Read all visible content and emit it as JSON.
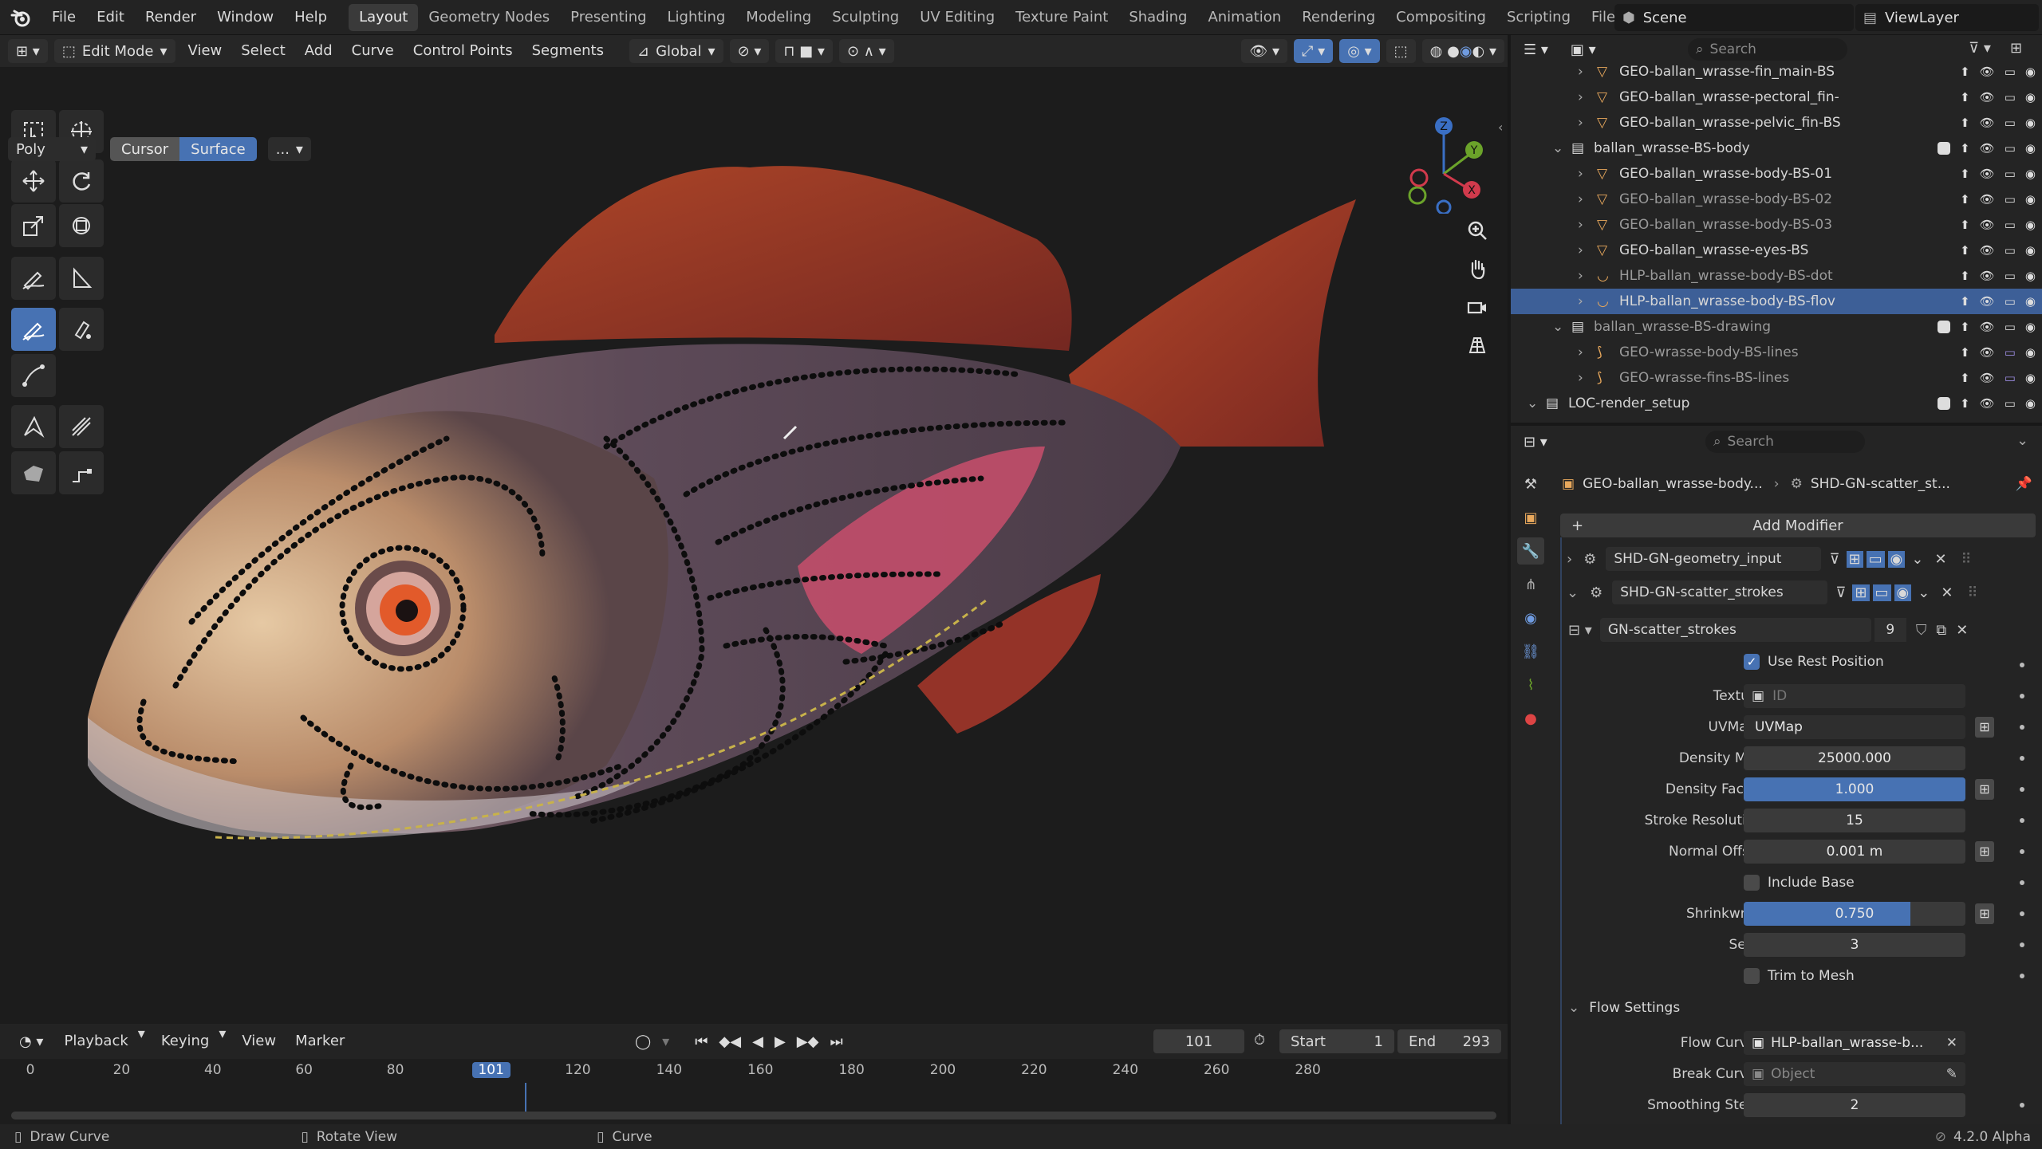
{
  "topbar": {
    "menus": [
      "File",
      "Edit",
      "Render",
      "Window",
      "Help"
    ],
    "workspaces": [
      "Layout",
      "Geometry Nodes",
      "Presenting",
      "Lighting",
      "Modeling",
      "Sculpting",
      "UV Editing",
      "Texture Paint",
      "Shading",
      "Animation",
      "Rendering",
      "Compositing",
      "Scripting",
      "File M"
    ],
    "active_workspace": "Layout",
    "scene": "Scene",
    "view_layer": "ViewLayer"
  },
  "header": {
    "mode": "Edit Mode",
    "menus": [
      "View",
      "Select",
      "Add",
      "Curve",
      "Control Points",
      "Segments"
    ],
    "transform_orientation": "Global"
  },
  "tool_settings": {
    "type": "Poly",
    "seg_cursor": "Cursor",
    "seg_surface": "Surface",
    "more": "..."
  },
  "outliner": {
    "search_placeholder": "Search",
    "rows": [
      {
        "label": "GEO-ballan_wrasse-fin_main-BS",
        "indent": 3,
        "type": "mesh"
      },
      {
        "label": "GEO-ballan_wrasse-pectoral_fin-",
        "indent": 3,
        "type": "mesh"
      },
      {
        "label": "GEO-ballan_wrasse-pelvic_fin-BS",
        "indent": 3,
        "type": "mesh"
      },
      {
        "label": "ballan_wrasse-BS-body",
        "indent": 2,
        "type": "collection"
      },
      {
        "label": "GEO-ballan_wrasse-body-BS-01",
        "indent": 3,
        "type": "mesh"
      },
      {
        "label": "GEO-ballan_wrasse-body-BS-02",
        "indent": 3,
        "type": "mesh",
        "dim": true
      },
      {
        "label": "GEO-ballan_wrasse-body-BS-03",
        "indent": 3,
        "type": "mesh",
        "dim": true
      },
      {
        "label": "GEO-ballan_wrasse-eyes-BS",
        "indent": 3,
        "type": "mesh"
      },
      {
        "label": "HLP-ballan_wrasse-body-BS-dot",
        "indent": 3,
        "type": "curve",
        "dim": true
      },
      {
        "label": "HLP-ballan_wrasse-body-BS-flov",
        "indent": 3,
        "type": "curve",
        "selected": true
      },
      {
        "label": "ballan_wrasse-BS-drawing",
        "indent": 2,
        "type": "collection",
        "dim": true
      },
      {
        "label": "GEO-wrasse-body-BS-lines",
        "indent": 3,
        "type": "gp",
        "dim": true
      },
      {
        "label": "GEO-wrasse-fins-BS-lines",
        "indent": 3,
        "type": "gp",
        "dim": true
      },
      {
        "label": "LOC-render_setup",
        "indent": 1,
        "type": "collection"
      }
    ]
  },
  "properties": {
    "search_placeholder": "Search",
    "breadcrumb_object": "GEO-ballan_wrasse-body...",
    "breadcrumb_modifier": "SHD-GN-scatter_st...",
    "add_modifier": "Add Modifier",
    "modifiers": [
      "SHD-GN-geometry_input",
      "SHD-GN-scatter_strokes"
    ],
    "node_group": "GN-scatter_strokes",
    "node_group_users": "9",
    "use_rest_position": "Use Rest Position",
    "fields": [
      {
        "label": "Texture",
        "value": "ID",
        "kind": "id"
      },
      {
        "label": "UVMap*",
        "value": "UVMap",
        "kind": "text"
      },
      {
        "label": "Density Max",
        "value": "25000.000",
        "kind": "num"
      },
      {
        "label": "Density Factor",
        "value": "1.000",
        "kind": "num",
        "fill": 1.0
      },
      {
        "label": "Stroke Resolution",
        "value": "15",
        "kind": "num"
      },
      {
        "label": "Normal Offset",
        "value": "0.001 m",
        "kind": "num"
      },
      {
        "label": "Include Base",
        "value": "",
        "kind": "check"
      },
      {
        "label": "Shrinkwrap",
        "value": "0.750",
        "kind": "num",
        "fill": 0.75
      },
      {
        "label": "Seed",
        "value": "3",
        "kind": "num"
      },
      {
        "label": "Trim to Mesh",
        "value": "",
        "kind": "check"
      }
    ],
    "flow_settings": "Flow Settings",
    "flow_curves_label": "Flow Curves",
    "flow_curves_value": "HLP-ballan_wrasse-b...",
    "break_curves_label": "Break Curves",
    "break_curves_value": "Object",
    "smoothing_steps_label": "Smoothing Steps",
    "smoothing_steps_value": "2"
  },
  "timeline": {
    "menus": [
      "Playback",
      "Keying",
      "View",
      "Marker"
    ],
    "current_frame": "101",
    "start_label": "Start",
    "start": "1",
    "end_label": "End",
    "end": "293",
    "ticks": [
      "0",
      "20",
      "40",
      "60",
      "80",
      "101",
      "120",
      "140",
      "160",
      "180",
      "200",
      "220",
      "240",
      "260",
      "280"
    ]
  },
  "status": {
    "left": "Draw Curve",
    "middle": "Rotate View",
    "right": "Curve",
    "version": "4.2.0 Alpha"
  },
  "colors": {
    "accent": "#4772b3",
    "selection": "#3d5f97"
  }
}
